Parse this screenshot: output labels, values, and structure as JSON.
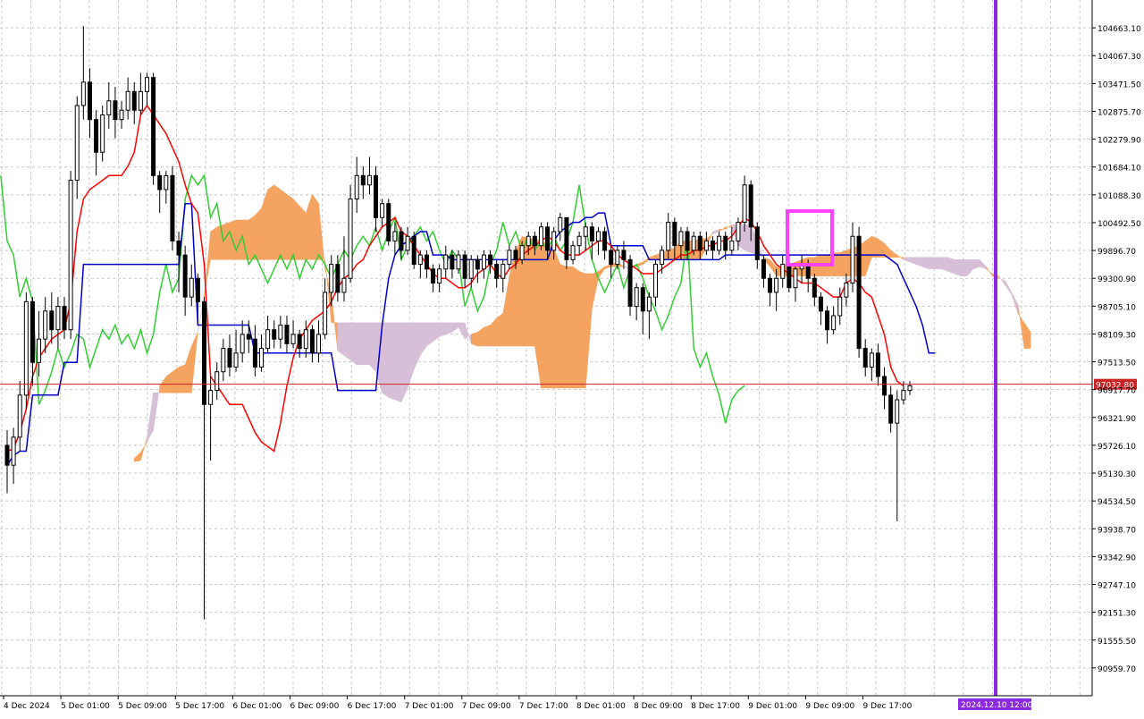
{
  "chart_data": {
    "type": "candlestick",
    "y_range": [
      90363.9,
      105259.0
    ],
    "y_ticks": [
      "104663.10",
      "104067.30",
      "103471.50",
      "102875.70",
      "102279.90",
      "101684.10",
      "101088.30",
      "100492.50",
      "99896.70",
      "99300.90",
      "98705.10",
      "98109.30",
      "97513.50",
      "96917.70",
      "96321.90",
      "95726.10",
      "95130.30",
      "94534.50",
      "93938.70",
      "93342.90",
      "92747.10",
      "92151.30",
      "91555.50",
      "90959.70"
    ],
    "x_labels": [
      "4 Dec 2024",
      "5 Dec 01:00",
      "5 Dec 09:00",
      "5 Dec 17:00",
      "6 Dec 01:00",
      "6 Dec 09:00",
      "6 Dec 17:00",
      "7 Dec 01:00",
      "7 Dec 09:00",
      "7 Dec 17:00",
      "8 Dec 01:00",
      "8 Dec 09:00",
      "8 Dec 17:00",
      "9 Dec 01:00",
      "9 Dec 09:00",
      "9 Dec 17:00"
    ],
    "current_price": "97032.80",
    "future_time_label": "2024.12.10 12:00",
    "candles": [
      [
        95726,
        95300,
        96050,
        94700
      ],
      [
        95300,
        95900,
        96100,
        94900
      ],
      [
        95900,
        96800,
        97100,
        95600
      ],
      [
        96800,
        98800,
        99000,
        96500
      ],
      [
        98800,
        97500,
        98900,
        97000
      ],
      [
        97500,
        98000,
        98600,
        97200
      ],
      [
        98000,
        98600,
        98900,
        97700
      ],
      [
        98600,
        98200,
        99000,
        97900
      ],
      [
        98200,
        98700,
        98900,
        97800
      ],
      [
        98700,
        98200,
        98900,
        98000
      ],
      [
        98200,
        101400,
        101600,
        98000
      ],
      [
        101400,
        103000,
        103200,
        101000
      ],
      [
        103000,
        103500,
        104700,
        102700
      ],
      [
        103500,
        102700,
        103800,
        102300
      ],
      [
        102700,
        102000,
        102900,
        101500
      ],
      [
        102000,
        102800,
        103000,
        101800
      ],
      [
        102800,
        103100,
        103500,
        102500
      ],
      [
        103100,
        102700,
        103400,
        102300
      ],
      [
        102700,
        102900,
        103100,
        102500
      ],
      [
        102900,
        103300,
        103600,
        102700
      ],
      [
        103300,
        102900,
        103500,
        102600
      ],
      [
        102900,
        103300,
        103700,
        102800
      ],
      [
        103300,
        103600,
        103700,
        103000
      ],
      [
        103600,
        101500,
        103700,
        101300
      ],
      [
        101500,
        101200,
        101600,
        100700
      ],
      [
        101200,
        101500,
        101600,
        100900
      ],
      [
        101500,
        100100,
        101700,
        99900
      ],
      [
        100100,
        99800,
        100300,
        99000
      ],
      [
        99800,
        98900,
        100000,
        98500
      ],
      [
        98900,
        99300,
        99600,
        98700
      ],
      [
        99300,
        98800,
        99400,
        98300
      ],
      [
        98800,
        96600,
        98900,
        92000
      ],
      [
        96600,
        96900,
        97200,
        95400
      ],
      [
        96900,
        97300,
        97500,
        96700
      ],
      [
        97300,
        97800,
        98000,
        97100
      ],
      [
        97800,
        97400,
        98100,
        97200
      ],
      [
        97400,
        97700,
        98200,
        97300
      ],
      [
        97700,
        98100,
        98400,
        97500
      ],
      [
        98100,
        98000,
        98400,
        97700
      ],
      [
        98000,
        97400,
        98300,
        97200
      ],
      [
        97400,
        97800,
        98100,
        97300
      ],
      [
        97800,
        98200,
        98500,
        97700
      ],
      [
        98200,
        98000,
        98400,
        97800
      ],
      [
        98000,
        98300,
        98500,
        97800
      ],
      [
        98300,
        97900,
        98500,
        97700
      ],
      [
        97900,
        98100,
        98400,
        97800
      ],
      [
        98100,
        97800,
        98200,
        97600
      ],
      [
        97800,
        98200,
        98400,
        97600
      ],
      [
        98200,
        97700,
        98300,
        97500
      ],
      [
        97700,
        98100,
        98400,
        97500
      ],
      [
        98100,
        99000,
        99300,
        98000
      ],
      [
        99000,
        99600,
        99800,
        98700
      ],
      [
        99600,
        99000,
        99800,
        98800
      ],
      [
        99000,
        99300,
        100200,
        98800
      ],
      [
        99300,
        101000,
        101300,
        99200
      ],
      [
        101000,
        101500,
        101900,
        100700
      ],
      [
        101500,
        101300,
        101700,
        101000
      ],
      [
        101300,
        101500,
        101900,
        101100
      ],
      [
        101500,
        100600,
        101700,
        100300
      ],
      [
        100600,
        100900,
        101000,
        100400
      ],
      [
        100900,
        100100,
        101000,
        100000
      ],
      [
        100100,
        100300,
        100500,
        99800
      ],
      [
        100300,
        99900,
        100400,
        99700
      ],
      [
        99900,
        100200,
        100400,
        99800
      ],
      [
        100200,
        99600,
        100300,
        99500
      ],
      [
        99600,
        99800,
        99900,
        99300
      ],
      [
        99800,
        99500,
        99900,
        99300
      ],
      [
        99500,
        99200,
        99600,
        99000
      ],
      [
        99200,
        99500,
        99600,
        99000
      ],
      [
        99500,
        99800,
        100000,
        99300
      ],
      [
        99800,
        99500,
        99900,
        99300
      ],
      [
        99500,
        99800,
        99900,
        99400
      ],
      [
        99800,
        99300,
        99900,
        99100
      ],
      [
        99300,
        99700,
        99800,
        99100
      ],
      [
        99700,
        99500,
        99800,
        99200
      ],
      [
        99500,
        99800,
        99900,
        99300
      ],
      [
        99800,
        99600,
        99900,
        99400
      ],
      [
        99600,
        99300,
        99700,
        99100
      ],
      [
        99300,
        99600,
        99700,
        99000
      ],
      [
        99600,
        99900,
        100000,
        99500
      ],
      [
        99900,
        99700,
        100000,
        99500
      ],
      [
        99700,
        100000,
        100100,
        99600
      ],
      [
        100000,
        100200,
        100300,
        99800
      ],
      [
        100200,
        100000,
        100300,
        99800
      ],
      [
        100000,
        100400,
        100500,
        99900
      ],
      [
        100400,
        99900,
        100500,
        99700
      ],
      [
        99900,
        100300,
        100400,
        99700
      ],
      [
        100300,
        100600,
        100700,
        100100
      ],
      [
        100600,
        99700,
        100600,
        99500
      ],
      [
        99700,
        100000,
        100100,
        99600
      ],
      [
        100000,
        100200,
        100300,
        99800
      ],
      [
        100200,
        100400,
        100500,
        99900
      ],
      [
        100400,
        100100,
        100500,
        99700
      ],
      [
        100100,
        100300,
        100400,
        99800
      ],
      [
        100300,
        99900,
        100400,
        99700
      ],
      [
        99900,
        99600,
        100000,
        99300
      ],
      [
        99600,
        99900,
        100000,
        99500
      ],
      [
        99900,
        99700,
        100100,
        99500
      ],
      [
        99700,
        98700,
        99800,
        98500
      ],
      [
        98700,
        99100,
        99200,
        98400
      ],
      [
        99100,
        98600,
        99200,
        98100
      ],
      [
        98600,
        98900,
        99000,
        98000
      ],
      [
        98900,
        99600,
        99700,
        98700
      ],
      [
        99600,
        99900,
        100000,
        99400
      ],
      [
        99900,
        100500,
        100700,
        99700
      ],
      [
        100500,
        100000,
        100600,
        99700
      ],
      [
        100000,
        100300,
        100400,
        99700
      ],
      [
        100300,
        99900,
        100400,
        99700
      ],
      [
        99900,
        100200,
        100300,
        99800
      ],
      [
        100200,
        99900,
        100300,
        99700
      ],
      [
        99900,
        100100,
        100300,
        99800
      ],
      [
        100100,
        99900,
        100200,
        99700
      ],
      [
        99900,
        100200,
        100300,
        99800
      ],
      [
        100200,
        99900,
        100300,
        99700
      ],
      [
        99900,
        100100,
        100400,
        99800
      ],
      [
        100100,
        100500,
        100600,
        99900
      ],
      [
        100500,
        101300,
        101500,
        100300
      ],
      [
        101300,
        100400,
        101400,
        100100
      ],
      [
        100400,
        99700,
        100500,
        99500
      ],
      [
        99700,
        99300,
        99800,
        99100
      ],
      [
        99300,
        99000,
        99400,
        98700
      ],
      [
        99000,
        99300,
        99500,
        98600
      ],
      [
        99300,
        99600,
        99800,
        99100
      ],
      [
        99600,
        99100,
        99800,
        99000
      ],
      [
        99100,
        99500,
        99600,
        98800
      ],
      [
        99500,
        99600,
        99800,
        99200
      ],
      [
        99600,
        99300,
        99700,
        99000
      ],
      [
        99300,
        98900,
        99400,
        98700
      ],
      [
        98900,
        98600,
        99000,
        98300
      ],
      [
        98600,
        98200,
        98700,
        97900
      ],
      [
        98200,
        98500,
        98700,
        98100
      ],
      [
        98500,
        98900,
        99100,
        98300
      ],
      [
        98900,
        99200,
        99400,
        98700
      ],
      [
        99200,
        100200,
        100500,
        99000
      ],
      [
        100200,
        97800,
        100400,
        97600
      ],
      [
        97800,
        97400,
        98000,
        97200
      ],
      [
        97400,
        97700,
        97800,
        97100
      ],
      [
        97700,
        97200,
        97900,
        97000
      ],
      [
        97200,
        96800,
        97400,
        96500
      ],
      [
        96800,
        96200,
        97000,
        96000
      ],
      [
        96200,
        96700,
        96900,
        94100
      ],
      [
        96700,
        96900,
        97100,
        96600
      ],
      [
        96900,
        97000,
        97100,
        96800
      ]
    ],
    "tenkan": [
      95600,
      95650,
      96000,
      96500,
      97200,
      97600,
      97800,
      98000,
      98100,
      98200,
      98800,
      100300,
      101000,
      101200,
      101300,
      101400,
      101500,
      101500,
      101500,
      101700,
      102000,
      102800,
      103000,
      102800,
      102600,
      102400,
      102100,
      101800,
      101300,
      100900,
      100700,
      99600,
      97200,
      97000,
      96800,
      96600,
      96600,
      96600,
      96300,
      96000,
      95800,
      95700,
      95600,
      96200,
      97000,
      97600,
      98000,
      98200,
      98400,
      98500,
      98600,
      98800,
      99100,
      99300,
      99400,
      99600,
      99700,
      100000,
      100200,
      100400,
      100500,
      100600,
      100300,
      100200,
      100000,
      99800,
      99600,
      99400,
      99300,
      99300,
      99200,
      99100,
      99100,
      99200,
      99400,
      99500,
      99600,
      99400,
      99300,
      99500,
      99600,
      99800,
      99900,
      100000,
      100100,
      100200,
      100100,
      99900,
      99800,
      99800,
      99800,
      99900,
      100000,
      100100,
      100100,
      100000,
      99800,
      99700,
      99600,
      99500,
      99400,
      99400,
      99400,
      99500,
      99600,
      99700,
      99800,
      99800,
      99900,
      99900,
      100000,
      100000,
      100100,
      100100,
      100200,
      100400,
      100600,
      100500,
      100300,
      100000,
      99800,
      99600,
      99500,
      99400,
      99300,
      99200,
      99200,
      99200,
      99100,
      99000,
      98900,
      98900,
      99200,
      99300,
      99200,
      99000,
      98900,
      98500,
      98100,
      97400,
      97100,
      97000
    ],
    "kijun": [
      95300,
      95500,
      95600,
      95600,
      96800,
      96800,
      96800,
      96800,
      96800,
      97500,
      97500,
      97500,
      99600,
      99600,
      99600,
      99600,
      99600,
      99600,
      99600,
      99600,
      99600,
      99600,
      99600,
      99600,
      99600,
      99600,
      99600,
      99600,
      100900,
      100900,
      98300,
      98300,
      98300,
      98300,
      98300,
      98300,
      98300,
      98300,
      98300,
      97700,
      97700,
      97700,
      97700,
      97700,
      97700,
      97700,
      97700,
      97700,
      97700,
      97700,
      97700,
      97700,
      96900,
      96900,
      96900,
      96900,
      96900,
      96900,
      96900,
      98300,
      99300,
      99800,
      100000,
      100100,
      100200,
      100300,
      100300,
      99800,
      99800,
      99800,
      99700,
      99700,
      99700,
      99700,
      99700,
      99700,
      99700,
      99700,
      99700,
      99700,
      99700,
      99700,
      99700,
      99700,
      99700,
      99700,
      100100,
      100300,
      100400,
      100500,
      100500,
      100600,
      100600,
      100700,
      100700,
      100000,
      100000,
      100000,
      100000,
      100000,
      100000,
      99700,
      99700,
      99700,
      99700,
      99700,
      99700,
      99700,
      99700,
      99700,
      99700,
      99700,
      99700,
      99800,
      99800,
      99800,
      99800,
      99800,
      99800,
      99800,
      99800,
      99800,
      99800,
      99800,
      99800,
      99800,
      99800,
      99800,
      99800,
      99800,
      99800,
      99800,
      99800,
      99800,
      99800,
      99800,
      99800,
      99800,
      99800,
      99700,
      99600,
      99300,
      99000,
      98700,
      98300,
      97700,
      97700
    ]
  }
}
